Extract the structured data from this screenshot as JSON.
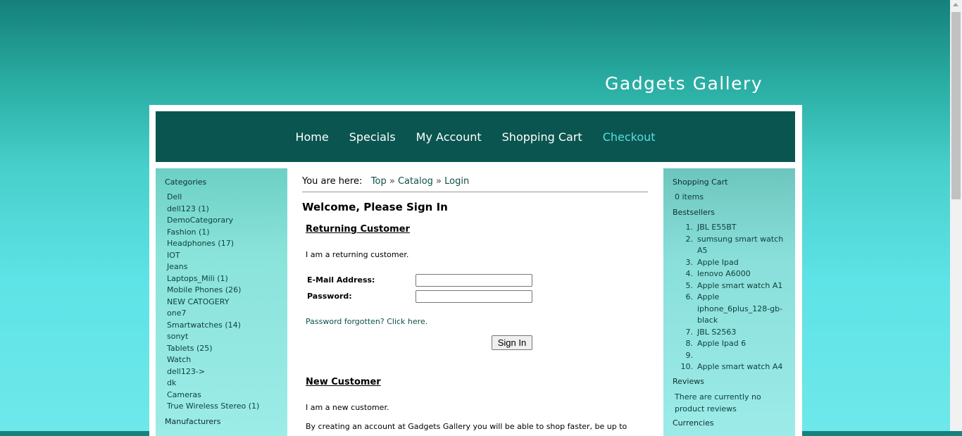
{
  "site": {
    "title": "Gadgets Gallery"
  },
  "nav": {
    "items": [
      {
        "label": "Home"
      },
      {
        "label": "Specials"
      },
      {
        "label": "My Account"
      },
      {
        "label": "Shopping Cart"
      },
      {
        "label": "Checkout"
      }
    ]
  },
  "categories": {
    "heading": "Categories",
    "items": [
      "Dell",
      "dell123 (1)",
      "DemoCategorary",
      "Fashion (1)",
      "Headphones (17)",
      "IOT",
      "Jeans",
      "Laptops_Mili (1)",
      "Mobile Phones (26)",
      "NEW CATOGERY",
      "one7",
      "Smartwatches (14)",
      "sonyt",
      "Tablets (25)",
      "Watch",
      "dell123->",
      "dk",
      "Cameras",
      "True Wireless Stereo (1)"
    ]
  },
  "manufacturers": {
    "heading": "Manufacturers"
  },
  "breadcrumb": {
    "prefix": "You are here:",
    "links": [
      "Top",
      "Catalog",
      "Login"
    ],
    "separator": "»"
  },
  "login": {
    "page_title": "Welcome, Please Sign In",
    "returning": {
      "title": "Returning Customer",
      "intro": "I am a returning customer.",
      "email_label": "E-Mail Address:",
      "email_value": "",
      "password_label": "Password:",
      "password_value": "",
      "forgot_text": "Password forgotten? Click here.",
      "signin_label": "Sign In"
    },
    "new_customer": {
      "title": "New Customer",
      "intro": "I am a new customer.",
      "body": "By creating an account at Gadgets Gallery you will be able to shop faster, be up to"
    }
  },
  "cart": {
    "heading": "Shopping Cart",
    "items_text": "0 items"
  },
  "bestsellers": {
    "heading": "Bestsellers",
    "items": [
      {
        "num": "1.",
        "name": "JBL E55BT"
      },
      {
        "num": "2.",
        "name": "sumsung smart watch A5"
      },
      {
        "num": "3.",
        "name": "Apple Ipad"
      },
      {
        "num": "4.",
        "name": "lenovo A6000"
      },
      {
        "num": "5.",
        "name": "Apple smart watch A1"
      },
      {
        "num": "6.",
        "name": "Apple iphone_6plus_128-gb-black"
      },
      {
        "num": "7.",
        "name": "JBL S2563"
      },
      {
        "num": "8.",
        "name": "Apple Ipad 6"
      },
      {
        "num": "9.",
        "name": ""
      },
      {
        "num": "10.",
        "name": "Apple smart watch A4"
      }
    ]
  },
  "reviews": {
    "heading": "Reviews",
    "text": "There are currently no product reviews"
  },
  "currencies": {
    "heading": "Currencies"
  }
}
